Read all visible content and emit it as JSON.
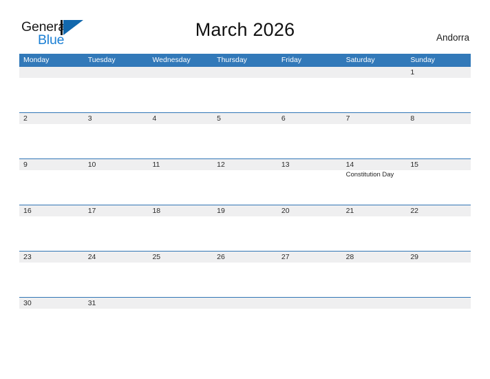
{
  "brand": {
    "name_part1": "General",
    "name_part2": "Blue",
    "flag_icon": "blue-triangle-flag-icon",
    "color_dark": "#1a1a1a",
    "color_blue": "#1b7fd4"
  },
  "header": {
    "title": "March 2026",
    "country": "Andorra"
  },
  "colors": {
    "header_blue": "#3279b9",
    "row_line_blue": "#2f74b5",
    "band_gray": "#efeff0",
    "page_background": "#ffffff",
    "text": "#2a2a2a"
  },
  "calendar": {
    "month": "March",
    "year": "2026",
    "weekday_headers": [
      "Monday",
      "Tuesday",
      "Wednesday",
      "Thursday",
      "Friday",
      "Saturday",
      "Sunday"
    ],
    "weeks": [
      {
        "days": [
          {
            "date": "",
            "event": ""
          },
          {
            "date": "",
            "event": ""
          },
          {
            "date": "",
            "event": ""
          },
          {
            "date": "",
            "event": ""
          },
          {
            "date": "",
            "event": ""
          },
          {
            "date": "",
            "event": ""
          },
          {
            "date": "1",
            "event": ""
          }
        ]
      },
      {
        "days": [
          {
            "date": "2",
            "event": ""
          },
          {
            "date": "3",
            "event": ""
          },
          {
            "date": "4",
            "event": ""
          },
          {
            "date": "5",
            "event": ""
          },
          {
            "date": "6",
            "event": ""
          },
          {
            "date": "7",
            "event": ""
          },
          {
            "date": "8",
            "event": ""
          }
        ]
      },
      {
        "days": [
          {
            "date": "9",
            "event": ""
          },
          {
            "date": "10",
            "event": ""
          },
          {
            "date": "11",
            "event": ""
          },
          {
            "date": "12",
            "event": ""
          },
          {
            "date": "13",
            "event": ""
          },
          {
            "date": "14",
            "event": "Constitution Day"
          },
          {
            "date": "15",
            "event": ""
          }
        ]
      },
      {
        "days": [
          {
            "date": "16",
            "event": ""
          },
          {
            "date": "17",
            "event": ""
          },
          {
            "date": "18",
            "event": ""
          },
          {
            "date": "19",
            "event": ""
          },
          {
            "date": "20",
            "event": ""
          },
          {
            "date": "21",
            "event": ""
          },
          {
            "date": "22",
            "event": ""
          }
        ]
      },
      {
        "days": [
          {
            "date": "23",
            "event": ""
          },
          {
            "date": "24",
            "event": ""
          },
          {
            "date": "25",
            "event": ""
          },
          {
            "date": "26",
            "event": ""
          },
          {
            "date": "27",
            "event": ""
          },
          {
            "date": "28",
            "event": ""
          },
          {
            "date": "29",
            "event": ""
          }
        ]
      },
      {
        "days": [
          {
            "date": "30",
            "event": ""
          },
          {
            "date": "31",
            "event": ""
          },
          {
            "date": "",
            "event": ""
          },
          {
            "date": "",
            "event": ""
          },
          {
            "date": "",
            "event": ""
          },
          {
            "date": "",
            "event": ""
          },
          {
            "date": "",
            "event": ""
          }
        ]
      }
    ]
  }
}
